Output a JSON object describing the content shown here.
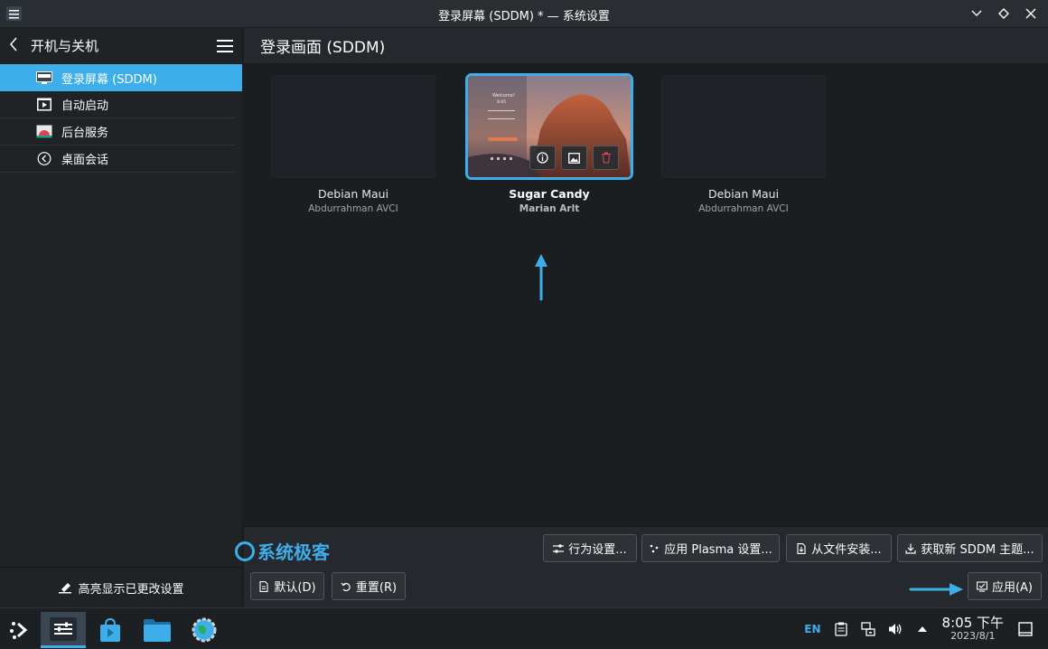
{
  "window": {
    "title": "登录屏幕 (SDDM) * — 系统设置"
  },
  "sidebar": {
    "heading": "开机与关机",
    "items": [
      {
        "label": "登录屏幕 (SDDM)",
        "icon": "monitor-icon",
        "active": true
      },
      {
        "label": "自动启动",
        "icon": "autostart-icon",
        "active": false
      },
      {
        "label": "后台服务",
        "icon": "services-icon",
        "active": false
      },
      {
        "label": "桌面会话",
        "icon": "session-icon",
        "active": false
      }
    ],
    "footer_label": "高亮显示已更改设置"
  },
  "main": {
    "title": "登录画面 (SDDM)",
    "themes": [
      {
        "name": "Debian Maui",
        "author": "Abdurrahman AVCI",
        "selected": false
      },
      {
        "name": "Sugar Candy",
        "author": "Marian Arlt",
        "selected": true,
        "preview_text": "Welcome!",
        "preview_time": "8:05"
      },
      {
        "name": "Debian Maui",
        "author": "Abdurrahman AVCI",
        "selected": false
      }
    ]
  },
  "buttons": {
    "behavior": "行为设置...",
    "apply_plasma": "应用 Plasma 设置...",
    "install_file": "从文件安装...",
    "get_new": "获取新 SDDM 主题...",
    "defaults": "默认(D)",
    "reset": "重置(R)",
    "apply": "应用(A)"
  },
  "watermark": "系统极客",
  "taskbar": {
    "lang": "EN",
    "time": "8:05 下午",
    "date": "2023/8/1"
  },
  "colors": {
    "accent": "#3daee9",
    "background": "#202326",
    "delete": "#da4453"
  }
}
